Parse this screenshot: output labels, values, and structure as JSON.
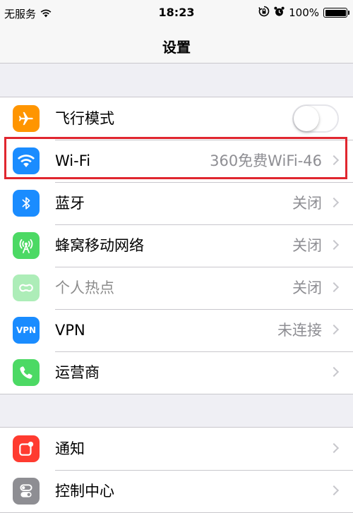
{
  "status_bar": {
    "carrier": "无服务",
    "time": "18:23",
    "battery_percent": "100%",
    "battery_level": 1.0,
    "icons": [
      "wifi-icon",
      "orientation-lock-icon",
      "alarm-icon",
      "battery-icon"
    ]
  },
  "nav": {
    "title": "设置"
  },
  "colors": {
    "airplane": "#ff9500",
    "wifi": "#1a8cff",
    "bluetooth": "#1a8cff",
    "cellular": "#4cd964",
    "hotspot": "#4cd964",
    "vpn": "#1a8cff",
    "carrier": "#4cd964",
    "notifications": "#ff3b30",
    "control_center": "#8e8e93",
    "highlight": "#e0262f"
  },
  "group1": {
    "rows": [
      {
        "label": "飞行模式",
        "icon": "airplane-icon",
        "toggle_on": false
      },
      {
        "label": "Wi-Fi",
        "value": "360免费WiFi-46",
        "icon": "wifi-icon"
      },
      {
        "label": "蓝牙",
        "value": "关闭",
        "icon": "bluetooth-icon"
      },
      {
        "label": "蜂窝移动网络",
        "value": "关闭",
        "icon": "cellular-antenna-icon"
      },
      {
        "label": "个人热点",
        "value": "关闭",
        "icon": "hotspot-link-icon",
        "disabled": true
      },
      {
        "label": "VPN",
        "value": "未连接",
        "icon": "vpn-icon",
        "icon_text": "VPN"
      },
      {
        "label": "运营商",
        "value": "",
        "icon": "phone-icon"
      }
    ]
  },
  "group2": {
    "rows": [
      {
        "label": "通知",
        "icon": "notifications-icon"
      },
      {
        "label": "控制中心",
        "icon": "control-center-icon"
      }
    ]
  }
}
